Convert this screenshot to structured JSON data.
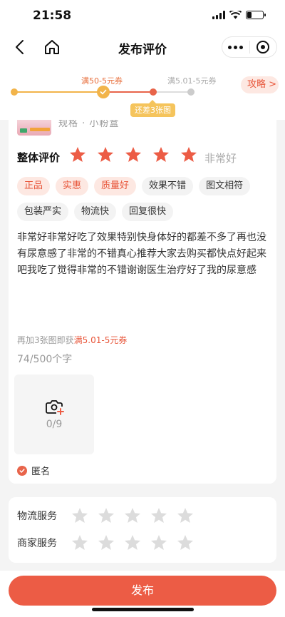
{
  "status_bar": {
    "time": "21:58"
  },
  "nav": {
    "title": "发布评价",
    "back_icon": "chevron-left-icon",
    "home_icon": "home-icon"
  },
  "progress": {
    "reward_1": "满50-5元券",
    "reward_2": "满5.01-5元券",
    "badge": "还差3张图",
    "strategy": "攻略 >"
  },
  "product": {
    "spec": "规格 · 小粉盒"
  },
  "rating": {
    "label": "整体评价",
    "stars": 5,
    "max": 5,
    "text": "非常好",
    "star_color": "#ec5c45"
  },
  "tags": [
    {
      "label": "正品",
      "selected": true
    },
    {
      "label": "实惠",
      "selected": true
    },
    {
      "label": "质量好",
      "selected": true
    },
    {
      "label": "效果不错",
      "selected": false
    },
    {
      "label": "图文相符",
      "selected": false
    },
    {
      "label": "包装严实",
      "selected": false
    },
    {
      "label": "物流快",
      "selected": false
    },
    {
      "label": "回复很快",
      "selected": false
    }
  ],
  "review": {
    "text": "非常好非常好吃了效果特别快身体好的都差不多了再也没有尿意感了非常的不错真心推荐大家去购买都快点好起来吧我吃了觉得非常的不错谢谢医生治疗好了我的尿意感",
    "photo_reward_prefix": "再加3张图即获",
    "photo_reward_highlight": "满5.01-5元券",
    "char_count": "74/500个字"
  },
  "upload": {
    "count": "0/9",
    "icon": "camera-add-icon"
  },
  "anonymous": {
    "label": "匿名",
    "checked": true
  },
  "services": [
    {
      "label": "物流服务",
      "stars": 0,
      "max": 5
    },
    {
      "label": "商家服务",
      "stars": 0,
      "max": 5
    }
  ],
  "publish": {
    "label": "发布"
  },
  "colors": {
    "accent": "#ec5c45",
    "warning": "#f2b44a",
    "tag_bg": "#fde8e2"
  }
}
